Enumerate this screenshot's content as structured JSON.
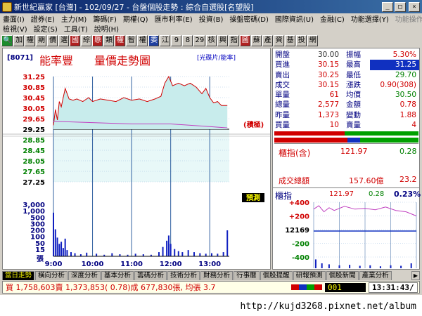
{
  "window": {
    "title": "新世紀贏家 [台灣] - 102/09/27 - 台盤個股走勢 : 綜合自選股[名望股]",
    "min_glyph": "_",
    "max_glyph": "□",
    "close_glyph": "×"
  },
  "menu": {
    "row1": [
      "畫面(I)",
      "證券(E)",
      "主力(M)",
      "籌碼(F)",
      "期權(Q)",
      "匯市利率(E)",
      "投資(B)",
      "操盤密碼(D)",
      "國際資訊(U)",
      "金融(C)",
      "功能選擇(Y)"
    ],
    "row1_dim": "功能操作(I)",
    "row2": [
      "檢視(V)",
      "設定(S)",
      "工具(T)",
      "說明(H)"
    ]
  },
  "toolbar": {
    "buttons": [
      {
        "label": "🔍",
        "style": "green"
      },
      {
        "label": "加",
        "style": ""
      },
      {
        "label": "權",
        "style": ""
      },
      {
        "label": "期",
        "style": ""
      },
      {
        "label": "價",
        "style": ""
      },
      {
        "label": "選",
        "style": ""
      },
      {
        "label": "國",
        "style": "red"
      },
      {
        "label": "綜",
        "style": ""
      },
      {
        "label": "懸",
        "style": "red"
      },
      {
        "label": "類",
        "style": ""
      },
      {
        "label": "權",
        "style": "red"
      },
      {
        "label": "智",
        "style": ""
      },
      {
        "label": "權",
        "style": ""
      },
      {
        "label": "委",
        "style": "blue"
      },
      {
        "label": "江",
        "style": ""
      },
      {
        "label": "9",
        "style": ""
      },
      {
        "label": "8",
        "style": ""
      },
      {
        "label": "29",
        "style": ""
      },
      {
        "label": "核",
        "style": ""
      },
      {
        "label": "興",
        "style": ""
      },
      {
        "label": "指",
        "style": ""
      },
      {
        "label": "圖",
        "style": "red"
      },
      {
        "label": "蘇",
        "style": ""
      },
      {
        "label": "產",
        "style": ""
      },
      {
        "label": "資",
        "style": ""
      },
      {
        "label": "基",
        "style": ""
      },
      {
        "label": "投",
        "style": ""
      },
      {
        "label": "網",
        "style": ""
      }
    ]
  },
  "stock": {
    "code": "[8071]",
    "name": "能率豐",
    "chart_title": "量價走勢圖",
    "subtitle": "[光碟片/能率]",
    "price_marker_label": "(積極)",
    "volume_marker_label": "預測",
    "volume_unit": "張"
  },
  "chart_data": {
    "type": "line",
    "title": "量價走勢圖",
    "price_axis_ticks": [
      "31.25",
      "30.85",
      "30.45",
      "30.05",
      "29.65",
      "29.25",
      "28.85",
      "28.45",
      "28.05",
      "27.65",
      "27.25"
    ],
    "price_ylim": [
      27.25,
      31.25
    ],
    "reference_price": 29.25,
    "volume_axis_ticks": [
      "3,000",
      "1,000",
      "500",
      "300",
      "200",
      "100",
      "50",
      "15"
    ],
    "x_ticks": [
      "9:00",
      "10:00",
      "11:00",
      "12:00",
      "13:00"
    ],
    "x_range": [
      "9:00",
      "13:30"
    ],
    "price_series": [
      {
        "t": 9.0,
        "v": 29.4
      },
      {
        "t": 9.05,
        "v": 30.0
      },
      {
        "t": 9.1,
        "v": 29.6
      },
      {
        "t": 9.15,
        "v": 30.3
      },
      {
        "t": 9.2,
        "v": 30.1
      },
      {
        "t": 9.3,
        "v": 30.8
      },
      {
        "t": 9.4,
        "v": 30.4
      },
      {
        "t": 9.5,
        "v": 30.35
      },
      {
        "t": 9.6,
        "v": 30.4
      },
      {
        "t": 9.75,
        "v": 30.3
      },
      {
        "t": 9.9,
        "v": 30.45
      },
      {
        "t": 10.0,
        "v": 30.3
      },
      {
        "t": 10.2,
        "v": 30.4
      },
      {
        "t": 10.4,
        "v": 30.35
      },
      {
        "t": 10.6,
        "v": 30.3
      },
      {
        "t": 10.8,
        "v": 30.45
      },
      {
        "t": 11.0,
        "v": 30.35
      },
      {
        "t": 11.2,
        "v": 30.4
      },
      {
        "t": 11.4,
        "v": 30.3
      },
      {
        "t": 11.6,
        "v": 30.4
      },
      {
        "t": 11.75,
        "v": 30.5
      },
      {
        "t": 11.85,
        "v": 31.0
      },
      {
        "t": 11.95,
        "v": 31.25
      },
      {
        "t": 12.05,
        "v": 30.9
      },
      {
        "t": 12.2,
        "v": 31.0
      },
      {
        "t": 12.35,
        "v": 30.9
      },
      {
        "t": 12.5,
        "v": 31.0
      },
      {
        "t": 12.65,
        "v": 30.85
      },
      {
        "t": 12.8,
        "v": 30.6
      },
      {
        "t": 12.9,
        "v": 30.8
      },
      {
        "t": 13.0,
        "v": 30.45
      },
      {
        "t": 13.1,
        "v": 30.25
      },
      {
        "t": 13.2,
        "v": 30.3
      },
      {
        "t": 13.3,
        "v": 30.15
      },
      {
        "t": 13.45,
        "v": 30.15
      }
    ],
    "avg_series": [
      {
        "t": 9.0,
        "v": 29.55
      },
      {
        "t": 10.0,
        "v": 29.5
      },
      {
        "t": 11.0,
        "v": 29.45
      },
      {
        "t": 12.0,
        "v": 29.45
      },
      {
        "t": 13.0,
        "v": 29.35
      },
      {
        "t": 13.45,
        "v": 29.3
      }
    ],
    "volume_bars": [
      {
        "t": 9.0,
        "v": 420
      },
      {
        "t": 9.05,
        "v": 260
      },
      {
        "t": 9.1,
        "v": 180
      },
      {
        "t": 9.15,
        "v": 120
      },
      {
        "t": 9.2,
        "v": 140
      },
      {
        "t": 9.25,
        "v": 80
      },
      {
        "t": 9.3,
        "v": 170
      },
      {
        "t": 9.35,
        "v": 60
      },
      {
        "t": 9.45,
        "v": 40
      },
      {
        "t": 9.55,
        "v": 30
      },
      {
        "t": 9.7,
        "v": 20
      },
      {
        "t": 9.85,
        "v": 35
      },
      {
        "t": 10.1,
        "v": 25
      },
      {
        "t": 10.3,
        "v": 15
      },
      {
        "t": 10.5,
        "v": 30
      },
      {
        "t": 10.7,
        "v": 20
      },
      {
        "t": 10.9,
        "v": 15
      },
      {
        "t": 11.1,
        "v": 25
      },
      {
        "t": 11.3,
        "v": 20
      },
      {
        "t": 11.5,
        "v": 15
      },
      {
        "t": 11.7,
        "v": 40
      },
      {
        "t": 11.8,
        "v": 90
      },
      {
        "t": 11.9,
        "v": 150
      },
      {
        "t": 11.95,
        "v": 200
      },
      {
        "t": 12.0,
        "v": 120
      },
      {
        "t": 12.1,
        "v": 70
      },
      {
        "t": 12.2,
        "v": 50
      },
      {
        "t": 12.3,
        "v": 40
      },
      {
        "t": 12.45,
        "v": 60
      },
      {
        "t": 12.6,
        "v": 40
      },
      {
        "t": 12.75,
        "v": 30
      },
      {
        "t": 12.9,
        "v": 25
      },
      {
        "t": 13.05,
        "v": 30
      },
      {
        "t": 13.2,
        "v": 25
      },
      {
        "t": 13.35,
        "v": 40
      },
      {
        "t": 13.45,
        "v": 250
      }
    ]
  },
  "quote": {
    "rows": [
      {
        "l1": "開盤",
        "v1": "30.00",
        "c1": "dark",
        "l2": "振幅",
        "v2": "5.30%",
        "c2": "red",
        "hl": false
      },
      {
        "l1": "買進",
        "v1": "30.15",
        "c1": "red",
        "l2": "最高",
        "v2": "31.25",
        "c2": "red",
        "hl": true
      },
      {
        "l1": "賣出",
        "v1": "30.25",
        "c1": "red",
        "l2": "最低",
        "v2": "29.70",
        "c2": "green",
        "hl": false
      },
      {
        "l1": "成交",
        "v1": "30.15",
        "c1": "red",
        "l2": "漲跌",
        "v2": "0.90(308)",
        "c2": "red",
        "hl": false
      },
      {
        "l1": "單量",
        "v1": "61",
        "c1": "red",
        "l2": "均價",
        "v2": "30.50",
        "c2": "green",
        "hl": false
      },
      {
        "l1": "總量",
        "v1": "2,577",
        "c1": "red",
        "l2": "金額",
        "v2": "0.78",
        "c2": "red",
        "hl": false
      },
      {
        "l1": "昨量",
        "v1": "1,373",
        "c1": "red",
        "l2": "變動",
        "v2": "1.88",
        "c2": "red",
        "hl": false
      },
      {
        "l1": "買量",
        "v1": "10",
        "c1": "red",
        "l2": "賣量",
        "v2": "4",
        "c2": "red",
        "hl": false
      }
    ]
  },
  "index": {
    "label": "櫃指(含)",
    "value": "121.97",
    "change": "0.28",
    "amount_label": "成交總額",
    "amount_value": "157.60億",
    "amount_change": "23.2"
  },
  "mini": {
    "title": "櫃指",
    "v1": "121.97",
    "v2": "0.28",
    "v3": "0.23%",
    "ticks": [
      "+400",
      "+200",
      "12169",
      "-200",
      "-400"
    ],
    "series": [
      {
        "t": 0,
        "v": 300
      },
      {
        "t": 0.05,
        "v": 350
      },
      {
        "t": 0.1,
        "v": 260
      },
      {
        "t": 0.15,
        "v": 320
      },
      {
        "t": 0.2,
        "v": 280
      },
      {
        "t": 0.3,
        "v": 340
      },
      {
        "t": 0.4,
        "v": 300
      },
      {
        "t": 0.5,
        "v": 310
      },
      {
        "t": 0.6,
        "v": 290
      },
      {
        "t": 0.7,
        "v": 330
      },
      {
        "t": 0.8,
        "v": 280
      },
      {
        "t": 0.9,
        "v": 260
      },
      {
        "t": 1.0,
        "v": 200
      }
    ],
    "vol_bars": [
      {
        "t": 0.02,
        "v": 0.9
      },
      {
        "t": 0.08,
        "v": 0.5
      },
      {
        "t": 0.15,
        "v": 0.4
      },
      {
        "t": 0.25,
        "v": 0.3
      },
      {
        "t": 0.35,
        "v": 0.35
      },
      {
        "t": 0.45,
        "v": 0.25
      },
      {
        "t": 0.55,
        "v": 0.3
      },
      {
        "t": 0.65,
        "v": 0.2
      },
      {
        "t": 0.75,
        "v": 0.3
      },
      {
        "t": 0.85,
        "v": 0.25
      },
      {
        "t": 0.95,
        "v": 0.5
      }
    ]
  },
  "tabs": {
    "items": [
      "當日走勢",
      "橫向分析",
      "深度分析",
      "基本分析",
      "籌碼分析",
      "技術分析",
      "財務分析",
      "行事曆",
      "個股提醒",
      "研報預測",
      "個股新聞",
      "產業分析"
    ],
    "active_index": 0,
    "scroll_glyph": "▶"
  },
  "status": {
    "text": "買 1,758,603賣 1,373,853( 0.78)成 677,830張, 均張 3.7",
    "code": "001",
    "time": "13:31:43/"
  },
  "footer": {
    "url": "http://kujd3268.pixnet.net/album"
  },
  "colors": {
    "price_line": "#d00000",
    "price_fill": "#c8ecec",
    "avg_line": "#c040c0",
    "volume_bar": "#1020c0",
    "grid_line": "#a0c0e0"
  }
}
